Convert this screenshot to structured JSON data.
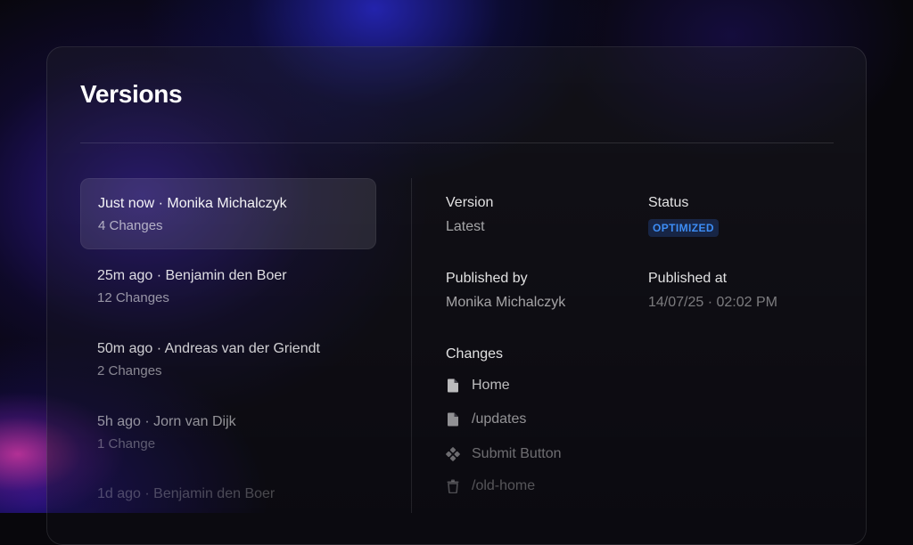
{
  "header": {
    "title": "Versions"
  },
  "versions": [
    {
      "time": "Just now",
      "author": "Monika Michalczyk",
      "changes": "4 Changes",
      "selected": true
    },
    {
      "time": "25m ago",
      "author": "Benjamin den Boer",
      "changes": "12 Changes",
      "selected": false
    },
    {
      "time": "50m ago",
      "author": "Andreas van der Griendt",
      "changes": "2 Changes",
      "selected": false
    },
    {
      "time": "5h ago",
      "author": "Jorn van Dijk",
      "changes": "1 Change",
      "selected": false
    },
    {
      "time": "1d ago",
      "author": "Benjamin den Boer",
      "changes": "",
      "selected": false
    }
  ],
  "details": {
    "version_label": "Version",
    "version_value": "Latest",
    "status_label": "Status",
    "status_badge": "OPTIMIZED",
    "published_by_label": "Published by",
    "published_by_value": "Monika Michalczyk",
    "published_at_label": "Published at",
    "published_at_value": "14/07/25 · 02:02 PM",
    "changes_label": "Changes",
    "changes": [
      {
        "icon": "page-icon",
        "label": "Home"
      },
      {
        "icon": "page-icon",
        "label": "/updates"
      },
      {
        "icon": "component-icon",
        "label": "Submit Button"
      },
      {
        "icon": "trash-icon",
        "label": "/old-home"
      }
    ]
  },
  "colors": {
    "accent": "#3d8df5",
    "background": "#08070c"
  }
}
